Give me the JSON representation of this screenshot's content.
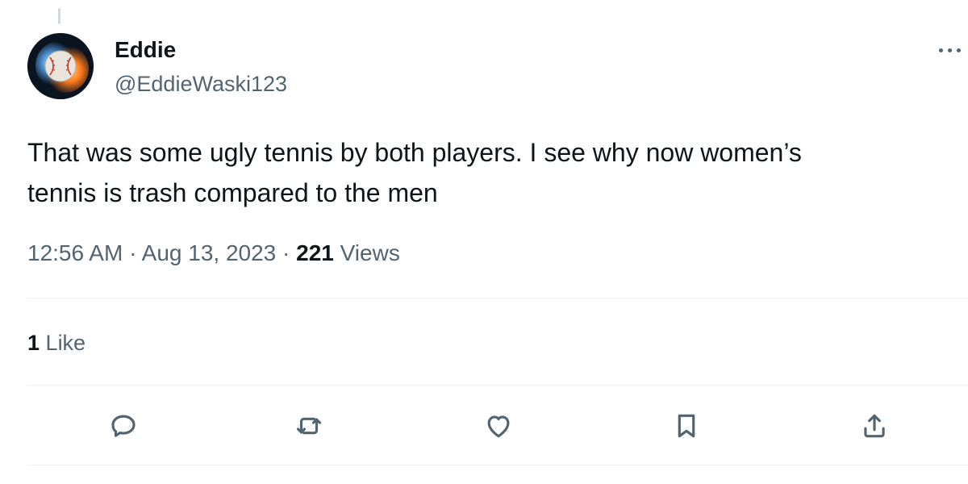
{
  "tweet": {
    "author": {
      "display_name": "Eddie",
      "handle": "@EddieWaski123",
      "avatar_icon": "baseball-fire-avatar"
    },
    "text": "That was some ugly tennis by both players. I see why now women’s\ntennis is trash compared to the men",
    "time": "12:56 AM",
    "separator": "·",
    "date": "Aug 13, 2023",
    "views_count": "221",
    "views_label": "Views",
    "likes_count": "1",
    "likes_label": "Like"
  },
  "actions": [
    {
      "name": "reply",
      "icon": "comment-icon"
    },
    {
      "name": "repost",
      "icon": "repost-icon"
    },
    {
      "name": "like",
      "icon": "heart-icon"
    },
    {
      "name": "bookmark",
      "icon": "bookmark-icon"
    },
    {
      "name": "share",
      "icon": "share-icon"
    }
  ],
  "colors": {
    "text_primary": "#0f1419",
    "text_secondary": "#536471",
    "divider": "#eff3f4"
  }
}
